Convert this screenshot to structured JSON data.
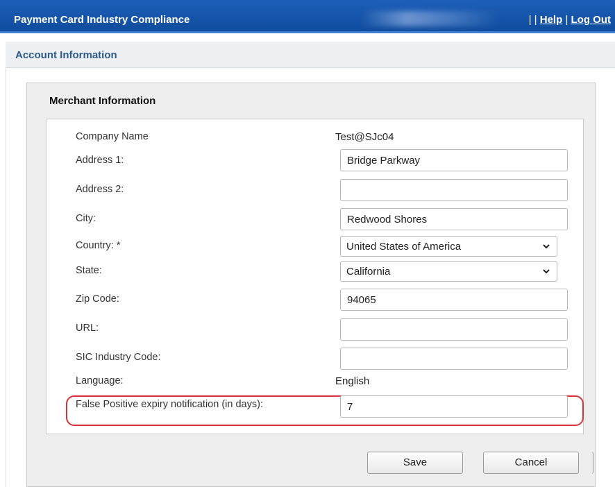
{
  "header": {
    "app_title": "Payment Card Industry Compliance",
    "separator": "| |",
    "help_label": "Help",
    "pipe": "|",
    "logout_label": "Log Out"
  },
  "page": {
    "section_title": "Account Information"
  },
  "merchant": {
    "heading": "Merchant Information",
    "company_name_label": "Company Name",
    "company_name_value": "Test@SJc04",
    "address1_label": "Address 1:",
    "address1_value": "Bridge Parkway",
    "address2_label": "Address 2:",
    "address2_value": "",
    "city_label": "City:",
    "city_value": "Redwood Shores",
    "country_label": "Country: *",
    "country_value": "United States of America",
    "state_label": "State:",
    "state_value": "California",
    "zip_label": "Zip Code:",
    "zip_value": "94065",
    "url_label": "URL:",
    "url_value": "",
    "sic_label": "SIC Industry Code:",
    "sic_value": "",
    "language_label": "Language:",
    "language_value": "English",
    "fp_label": "False Positive expiry notification (in days):",
    "fp_value": "7"
  },
  "actions": {
    "save_label": "Save",
    "cancel_label": "Cancel"
  },
  "colors": {
    "header_blue": "#1557ad",
    "section_text": "#2c5a8c",
    "highlight_red": "#d9303a"
  },
  "icons": {
    "select_arrow": "chevron-down-icon"
  }
}
